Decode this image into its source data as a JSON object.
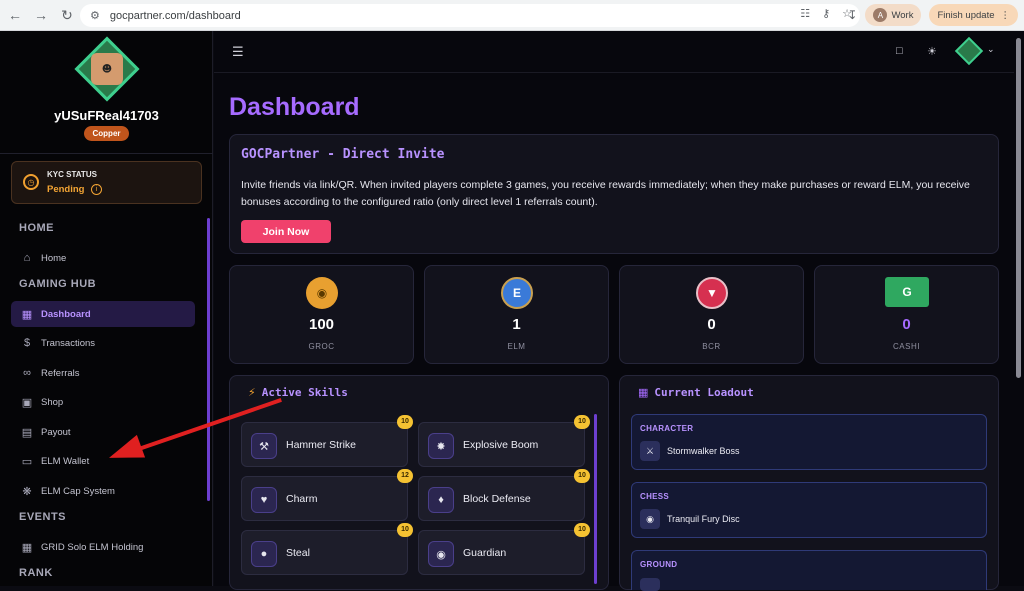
{
  "browser": {
    "url": "gocpartner.com/dashboard",
    "profile_initial": "A",
    "profile_label": "Work",
    "update_label": "Finish update"
  },
  "sidebar": {
    "username": "yUSuFReal41703",
    "rank": "Copper",
    "kyc": {
      "title": "KYC STATUS",
      "status": "Pending"
    },
    "sections": {
      "home": "HOME",
      "gaming_hub": "GAMING HUB",
      "events": "EVENTS",
      "rank": "RANK"
    },
    "items": [
      {
        "label": "Home",
        "icon": "home-icon"
      },
      {
        "label": "Dashboard",
        "icon": "grid-icon"
      },
      {
        "label": "Transactions",
        "icon": "dollar-icon"
      },
      {
        "label": "Referrals",
        "icon": "link-icon"
      },
      {
        "label": "Shop",
        "icon": "shop-icon"
      },
      {
        "label": "Payout",
        "icon": "clipboard-icon"
      },
      {
        "label": "ELM Wallet",
        "icon": "wallet-icon"
      },
      {
        "label": "ELM Cap System",
        "icon": "settings-icon"
      },
      {
        "label": "GRID Solo ELM Holding",
        "icon": "calendar-icon"
      }
    ]
  },
  "main": {
    "title": "Dashboard",
    "invite": {
      "title": "GOCPartner - Direct Invite",
      "description": "Invite friends via link/QR. When invited players complete 3 games, you receive rewards immediately; when they make purchases or reward ELM, you receive bonuses according to the configured ratio (only direct level 1 referrals count).",
      "button": "Join Now"
    },
    "stats": [
      {
        "value": "100",
        "label": "GROC",
        "color": "#e8a030"
      },
      {
        "value": "1",
        "label": "ELM",
        "color": "#3a7ad8"
      },
      {
        "value": "0",
        "label": "BCR",
        "color": "#d63050"
      },
      {
        "value": "0",
        "label": "CASHI",
        "color": "#2fa860"
      }
    ],
    "active_skills": {
      "title": "Active Skills",
      "skills": [
        {
          "name": "Hammer Strike",
          "level": "10"
        },
        {
          "name": "Explosive Boom",
          "level": "10"
        },
        {
          "name": "Charm",
          "level": "12"
        },
        {
          "name": "Block Defense",
          "level": "10"
        },
        {
          "name": "Steal",
          "level": "10"
        },
        {
          "name": "Guardian",
          "level": "10"
        }
      ]
    },
    "loadout": {
      "title": "Current Loadout",
      "slots": [
        {
          "label": "CHARACTER",
          "name": "Stormwalker Boss"
        },
        {
          "label": "CHESS",
          "name": "Tranquil Fury Disc"
        },
        {
          "label": "GROUND",
          "name": ""
        }
      ]
    }
  }
}
